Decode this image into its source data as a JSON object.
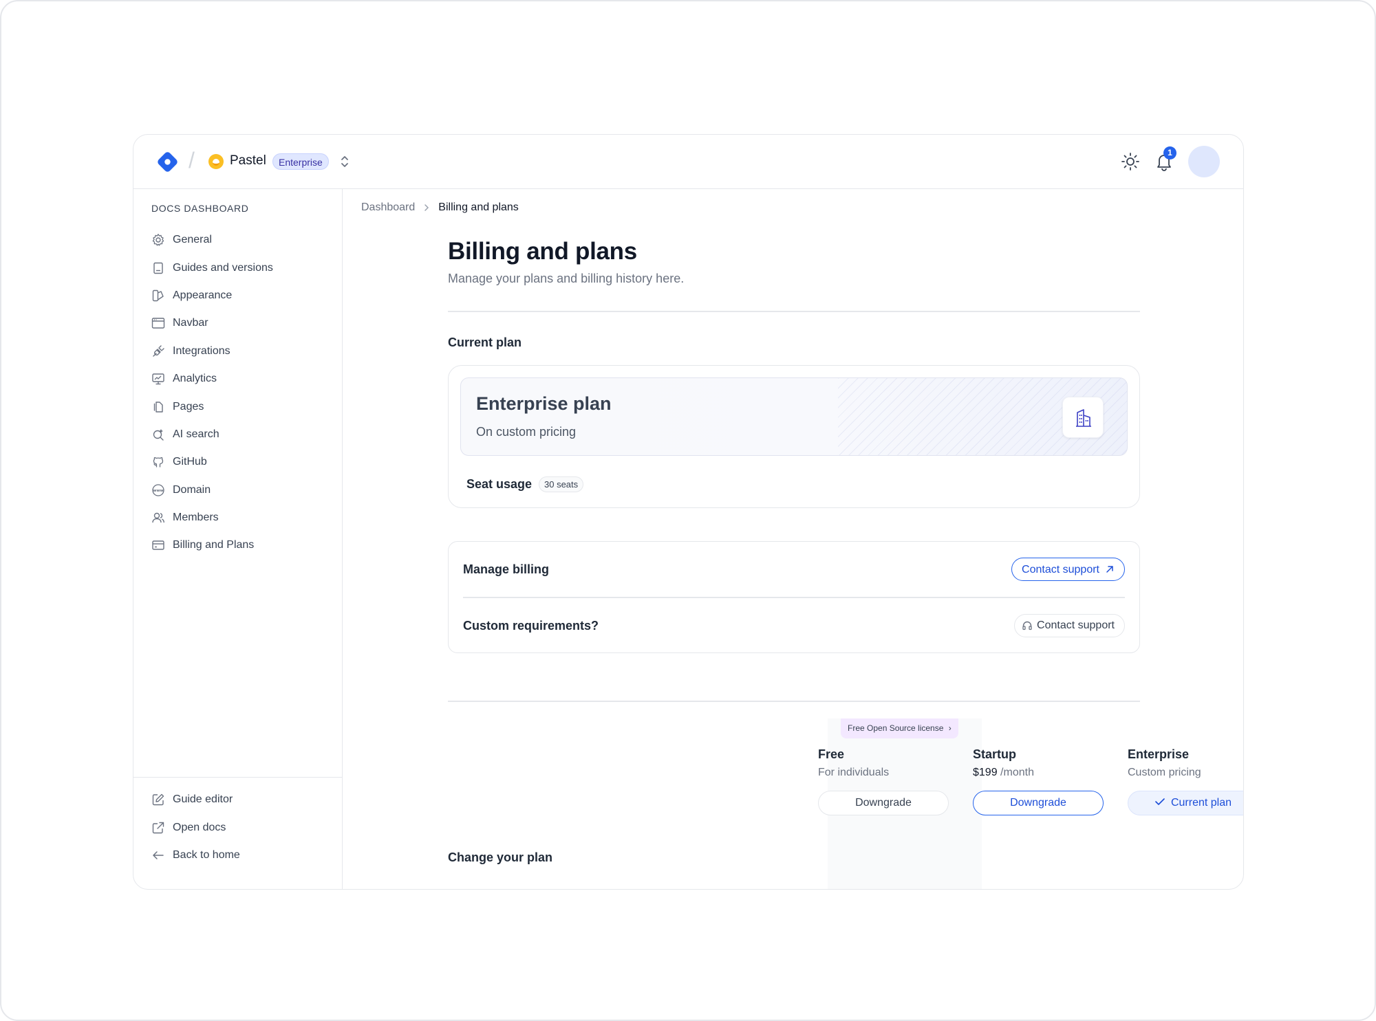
{
  "project": {
    "name": "Pastel",
    "badge": "Enterprise"
  },
  "topbar": {
    "notification_count": "1"
  },
  "sidebar": {
    "heading": "DOCS DASHBOARD",
    "items": [
      {
        "label": "General",
        "icon": "gear-icon"
      },
      {
        "label": "Guides and versions",
        "icon": "book-icon"
      },
      {
        "label": "Appearance",
        "icon": "palette-icon"
      },
      {
        "label": "Navbar",
        "icon": "browser-window-icon"
      },
      {
        "label": "Integrations",
        "icon": "plug-icon"
      },
      {
        "label": "Analytics",
        "icon": "chart-monitor-icon"
      },
      {
        "label": "Pages",
        "icon": "pages-icon"
      },
      {
        "label": "AI search",
        "icon": "ai-search-icon"
      },
      {
        "label": "GitHub",
        "icon": "github-icon"
      },
      {
        "label": "Domain",
        "icon": "globe-www-icon"
      },
      {
        "label": "Members",
        "icon": "users-icon"
      },
      {
        "label": "Billing and Plans",
        "icon": "credit-card-icon"
      }
    ],
    "bottom": [
      {
        "label": "Guide editor",
        "icon": "edit-icon"
      },
      {
        "label": "Open docs",
        "icon": "external-link-icon"
      },
      {
        "label": "Back to home",
        "icon": "arrow-left-icon"
      }
    ]
  },
  "breadcrumb": {
    "parent": "Dashboard",
    "current": "Billing and plans"
  },
  "page": {
    "title": "Billing and plans",
    "subtitle": "Manage your plans and billing history here."
  },
  "current_plan": {
    "section_title": "Current plan",
    "plan_name": "Enterprise plan",
    "pricing": "On custom pricing",
    "seat_label": "Seat usage",
    "seat_count": "30 seats"
  },
  "billing": {
    "manage_label": "Manage billing",
    "manage_button": "Contact support",
    "custom_label": "Custom requirements?",
    "custom_button": "Contact support"
  },
  "change_plan": {
    "section_title": "Change your plan",
    "oss_tag": "Free Open Source license",
    "tiers": [
      {
        "name": "Free",
        "desc": "For individuals",
        "button": "Downgrade"
      },
      {
        "name": "Startup",
        "price": "$199",
        "price_suffix": "/month",
        "button": "Downgrade"
      },
      {
        "name": "Enterprise",
        "desc": "Custom pricing",
        "button": "Current plan"
      }
    ]
  },
  "colors": {
    "accent": "#2563eb",
    "oss_tag_bg": "#f3e8ff",
    "enterprise_badge_bg": "#e0e7ff"
  }
}
